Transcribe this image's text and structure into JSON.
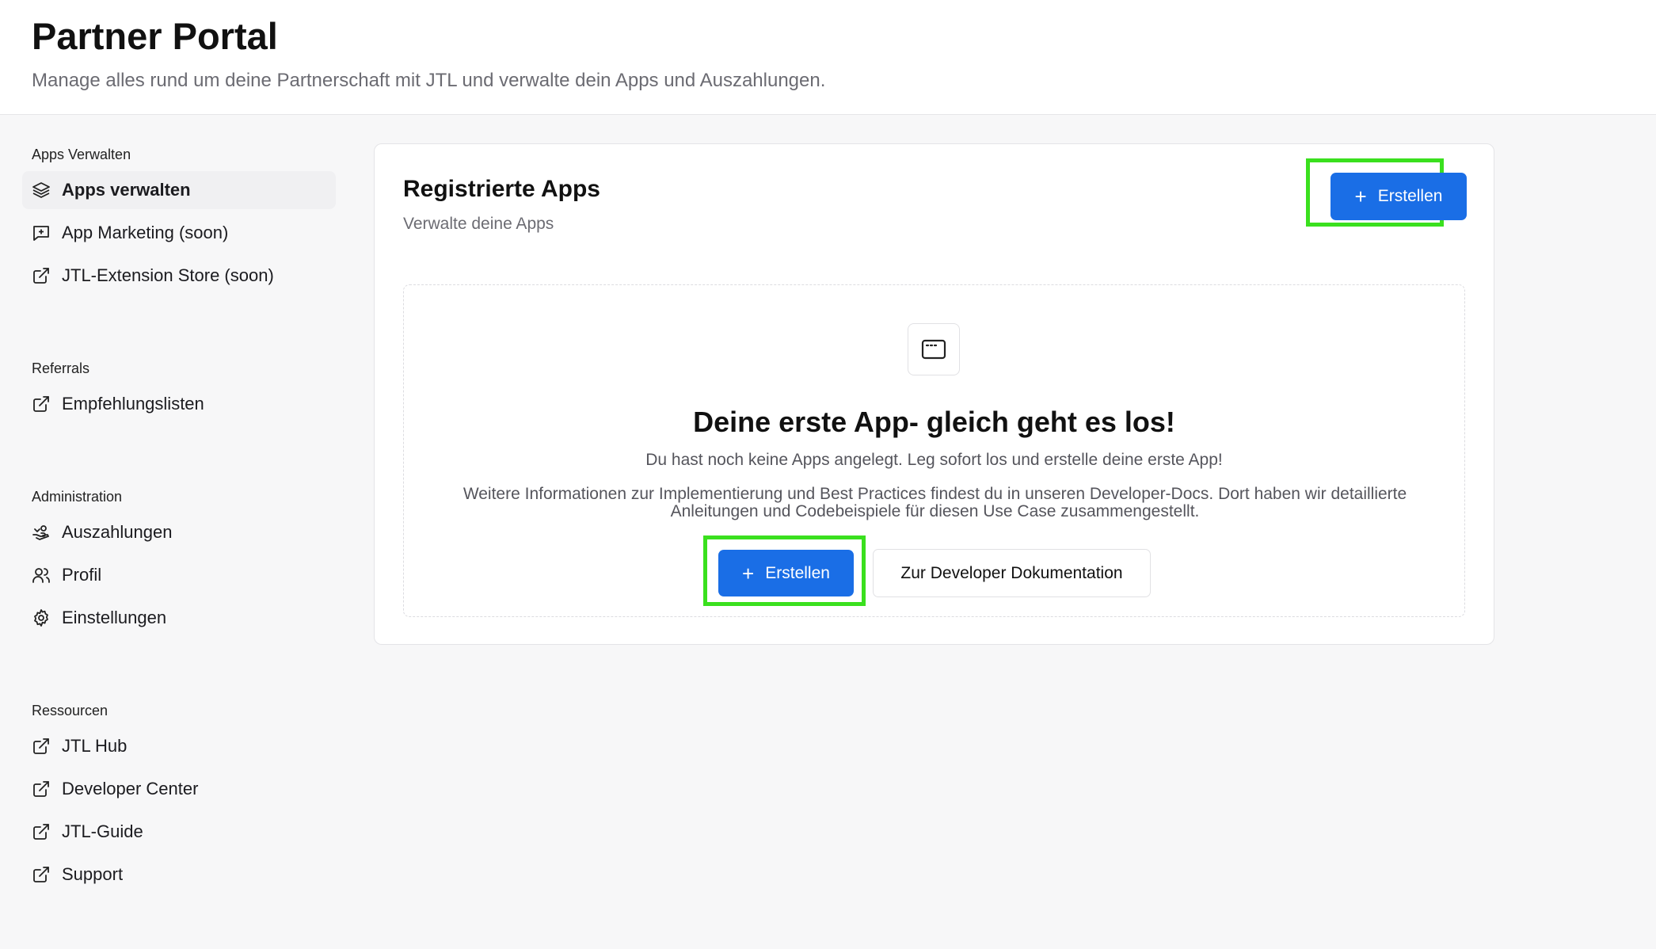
{
  "header": {
    "title": "Partner Portal",
    "subtitle": "Manage alles rund um deine Partnerschaft mit JTL und verwalte dein Apps und Auszahlungen."
  },
  "sidebar": {
    "sections": [
      {
        "heading": "Apps Verwalten",
        "items": [
          {
            "label": "Apps verwalten",
            "icon": "layers-icon",
            "active": true
          },
          {
            "label": "App Marketing (soon)",
            "icon": "message-plus-icon"
          },
          {
            "label": "JTL-Extension Store (soon)",
            "icon": "external-link-icon"
          }
        ]
      },
      {
        "heading": "Referrals",
        "items": [
          {
            "label": "Empfehlungslisten",
            "icon": "external-link-icon"
          }
        ]
      },
      {
        "heading": "Administration",
        "items": [
          {
            "label": "Auszahlungen",
            "icon": "payout-hand-icon"
          },
          {
            "label": "Profil",
            "icon": "users-icon"
          },
          {
            "label": "Einstellungen",
            "icon": "gear-icon"
          }
        ]
      },
      {
        "heading": "Ressourcen",
        "items": [
          {
            "label": "JTL Hub",
            "icon": "external-link-icon"
          },
          {
            "label": "Developer Center",
            "icon": "external-link-icon"
          },
          {
            "label": "JTL-Guide",
            "icon": "external-link-icon"
          },
          {
            "label": "Support",
            "icon": "external-link-icon"
          }
        ]
      }
    ]
  },
  "main": {
    "title": "Registrierte Apps",
    "subtitle": "Verwalte deine Apps",
    "create_label": "Erstellen",
    "empty_state": {
      "icon": "app-window-icon",
      "title": "Deine erste App- gleich geht es los!",
      "description": "Du hast noch keine Apps angelegt. Leg sofort los und erstelle deine erste App!",
      "info": "Weitere Informationen zur Implementierung und Best Practices findest du in unseren Developer-Docs. Dort haben wir detaillierte Anleitungen und Codebeispiele für diesen Use Case zusammengestellt.",
      "create_label": "Erstellen",
      "docs_label": "Zur Developer Dokumentation"
    }
  },
  "colors": {
    "primary": "#1a6ee6",
    "highlight": "#3ae01e"
  }
}
